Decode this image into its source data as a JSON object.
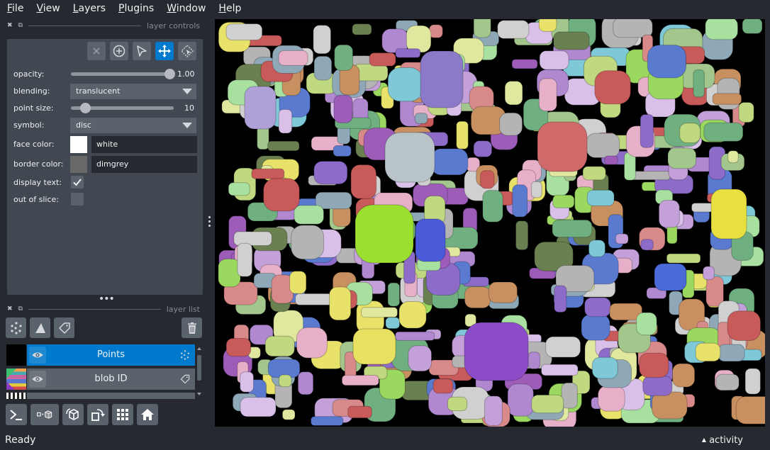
{
  "menubar": {
    "items": [
      {
        "label": "File",
        "underline": "F",
        "rest": "ile"
      },
      {
        "label": "View",
        "underline": "V",
        "rest": "iew"
      },
      {
        "label": "Layers",
        "underline": "L",
        "rest": "ayers"
      },
      {
        "label": "Plugins",
        "underline": "P",
        "rest": "lugins"
      },
      {
        "label": "Window",
        "underline": "W",
        "rest": "indow"
      },
      {
        "label": "Help",
        "underline": "H",
        "rest": "elp"
      }
    ]
  },
  "layer_controls": {
    "title": "layer controls",
    "opacity_label": "opacity:",
    "opacity_value": "1.00",
    "opacity_fraction": 1.0,
    "blending_label": "blending:",
    "blending_value": "translucent",
    "point_size_label": "point size:",
    "point_size_value": "10",
    "point_size_fraction": 0.1,
    "symbol_label": "symbol:",
    "symbol_value": "disc",
    "face_color_label": "face color:",
    "face_color_value": "white",
    "face_color_hex": "#ffffff",
    "border_color_label": "border color:",
    "border_color_value": "dimgrey",
    "border_color_hex": "#696969",
    "display_text_label": "display text:",
    "display_text_checked": true,
    "out_of_slice_label": "out of slice:",
    "out_of_slice_checked": false,
    "tools": [
      "delete-selected",
      "add-points",
      "select-points",
      "pan-zoom",
      "transform"
    ],
    "active_tool": "pan-zoom"
  },
  "layer_list": {
    "title": "layer list",
    "layers": [
      {
        "name": "Points",
        "selected": true,
        "visible": true,
        "type": "points"
      },
      {
        "name": "blob ID",
        "selected": false,
        "visible": true,
        "type": "labels"
      }
    ]
  },
  "status": {
    "text": "Ready",
    "activity_label": "activity"
  },
  "colors": {
    "accent": "#007acc",
    "background": "#262930",
    "panel": "#414851",
    "button": "#5a626c"
  }
}
